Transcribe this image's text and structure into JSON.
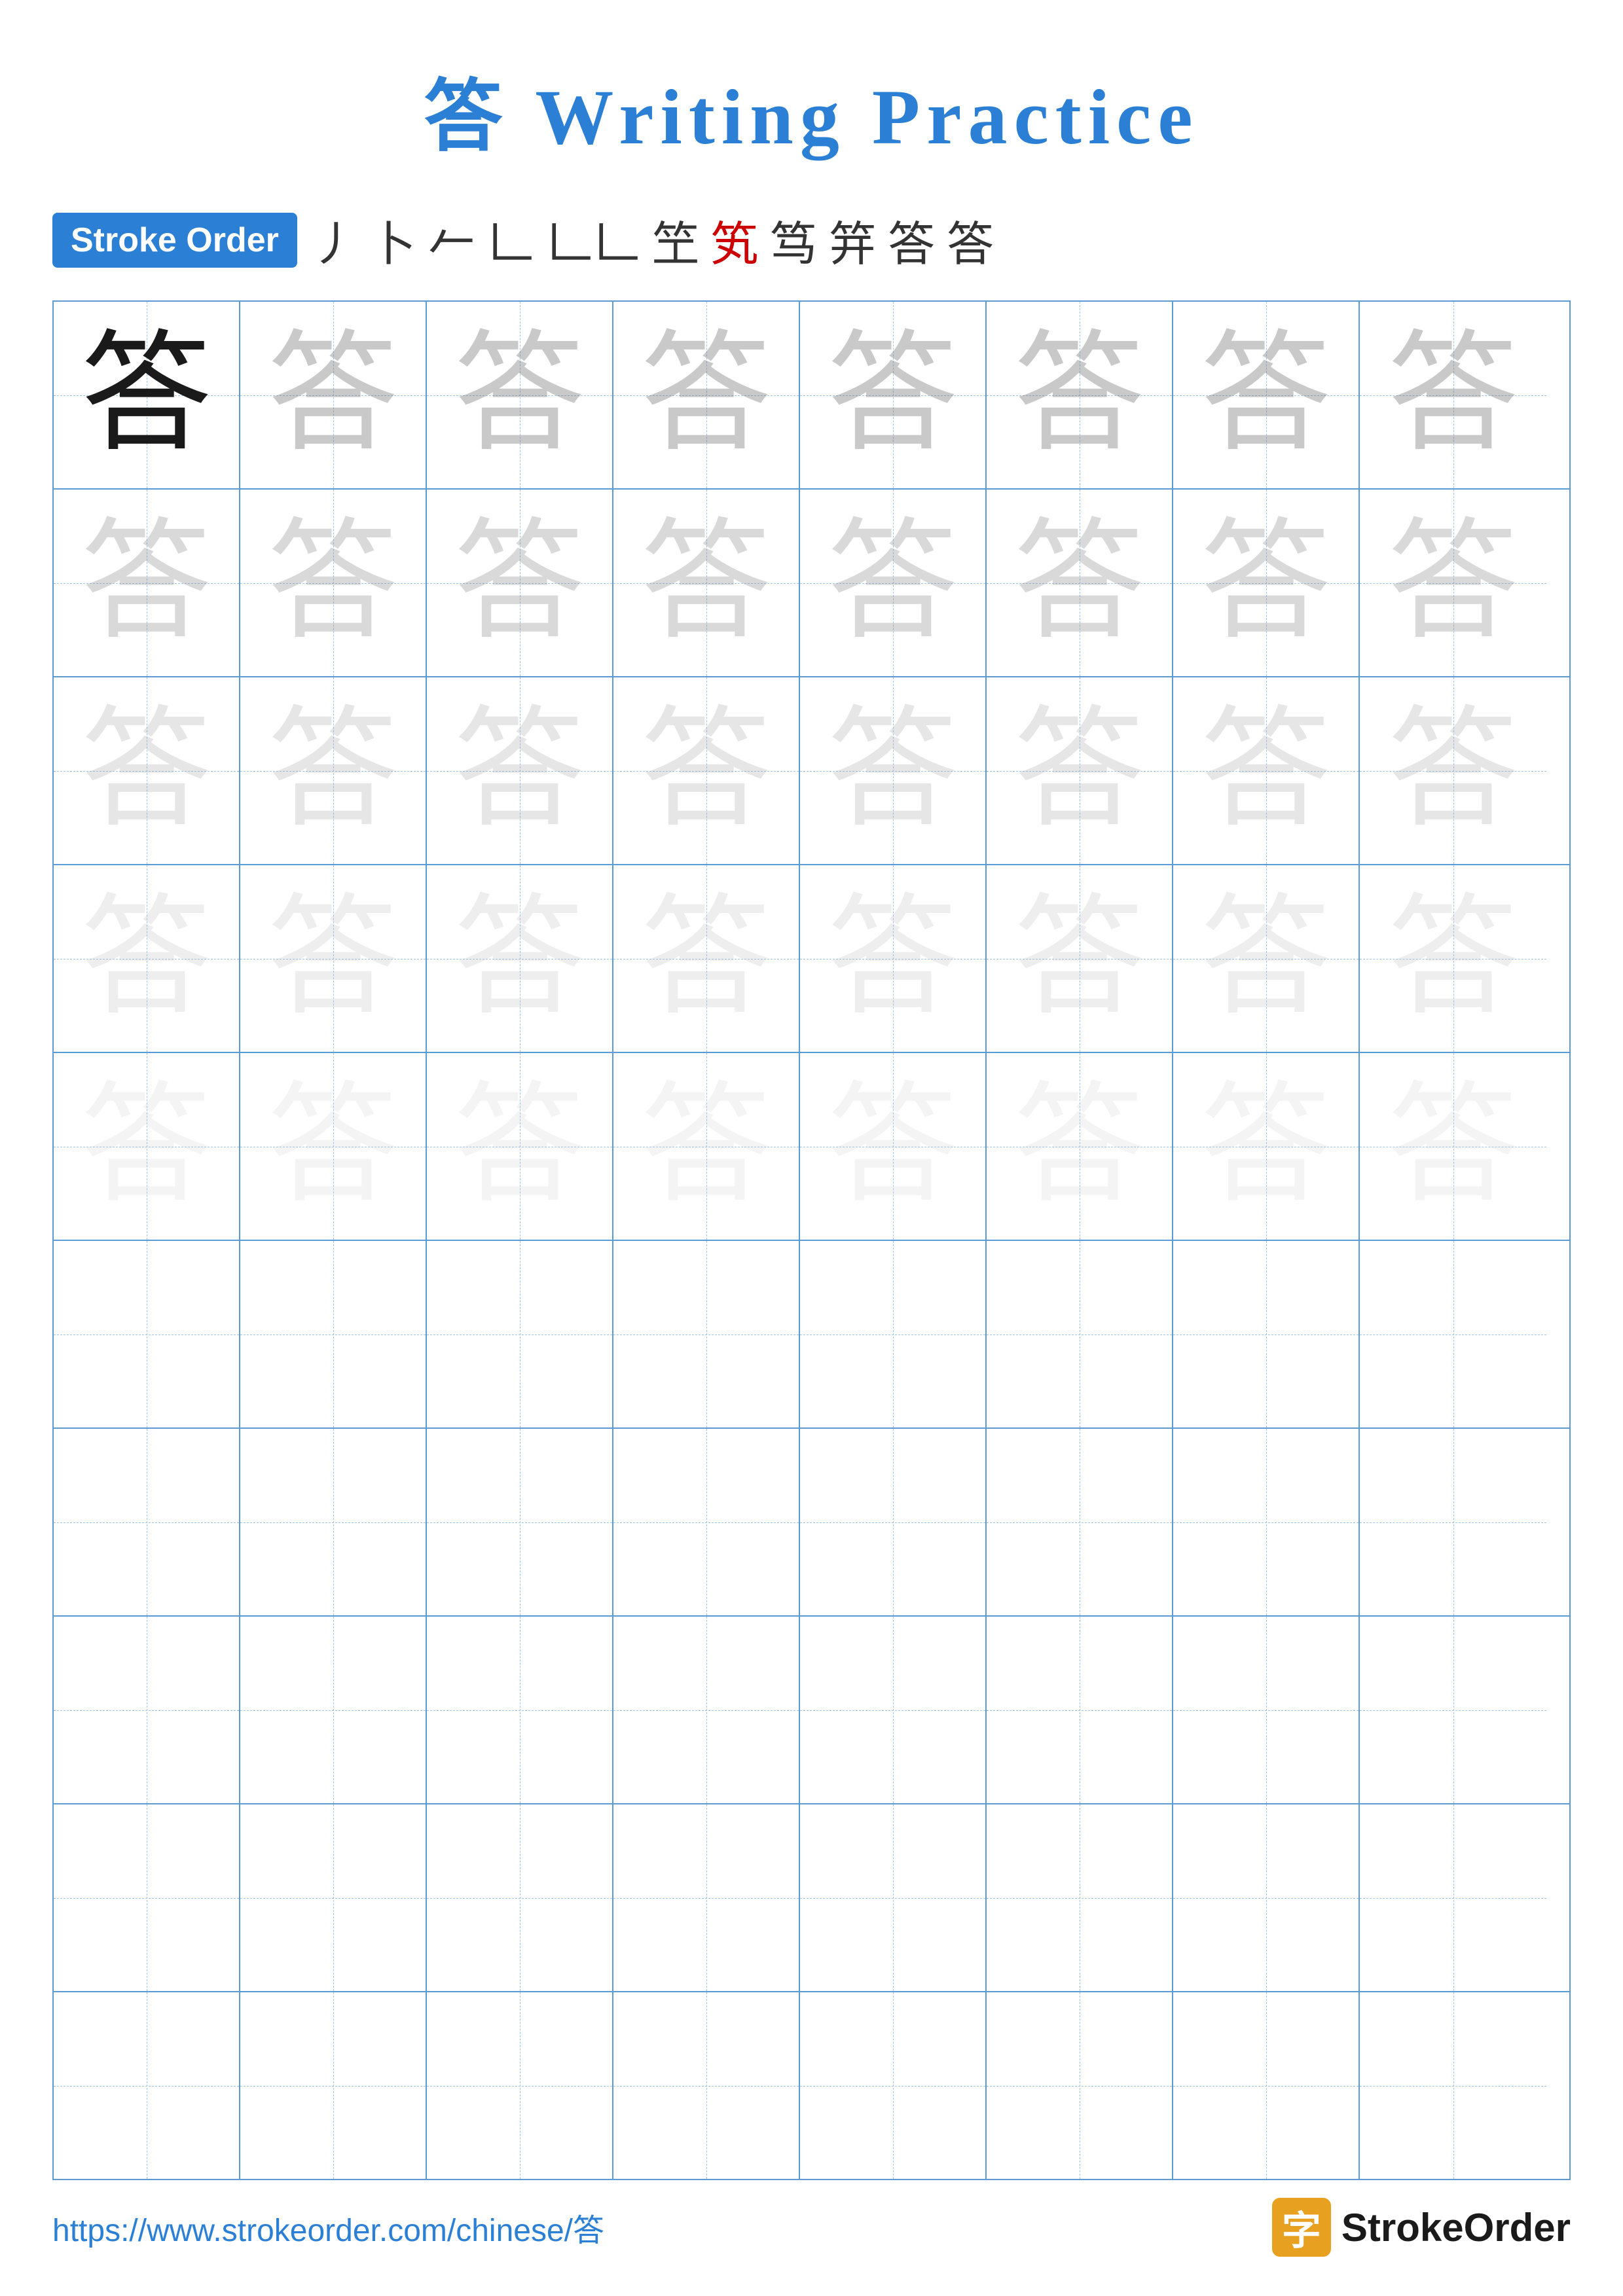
{
  "title": "答 Writing Practice",
  "stroke_order": {
    "badge_label": "Stroke Order",
    "strokes": [
      "丿",
      "卜",
      "𠂉",
      "𠃊",
      "𠃊𠃊",
      "笁",
      "笂",
      "笃",
      "笄",
      "答",
      "答"
    ]
  },
  "character": "答",
  "grid": {
    "rows": 10,
    "cols": 8
  },
  "footer": {
    "url": "https://www.strokeorder.com/chinese/答",
    "logo_text": "StrokeOrder",
    "logo_icon": "字"
  }
}
